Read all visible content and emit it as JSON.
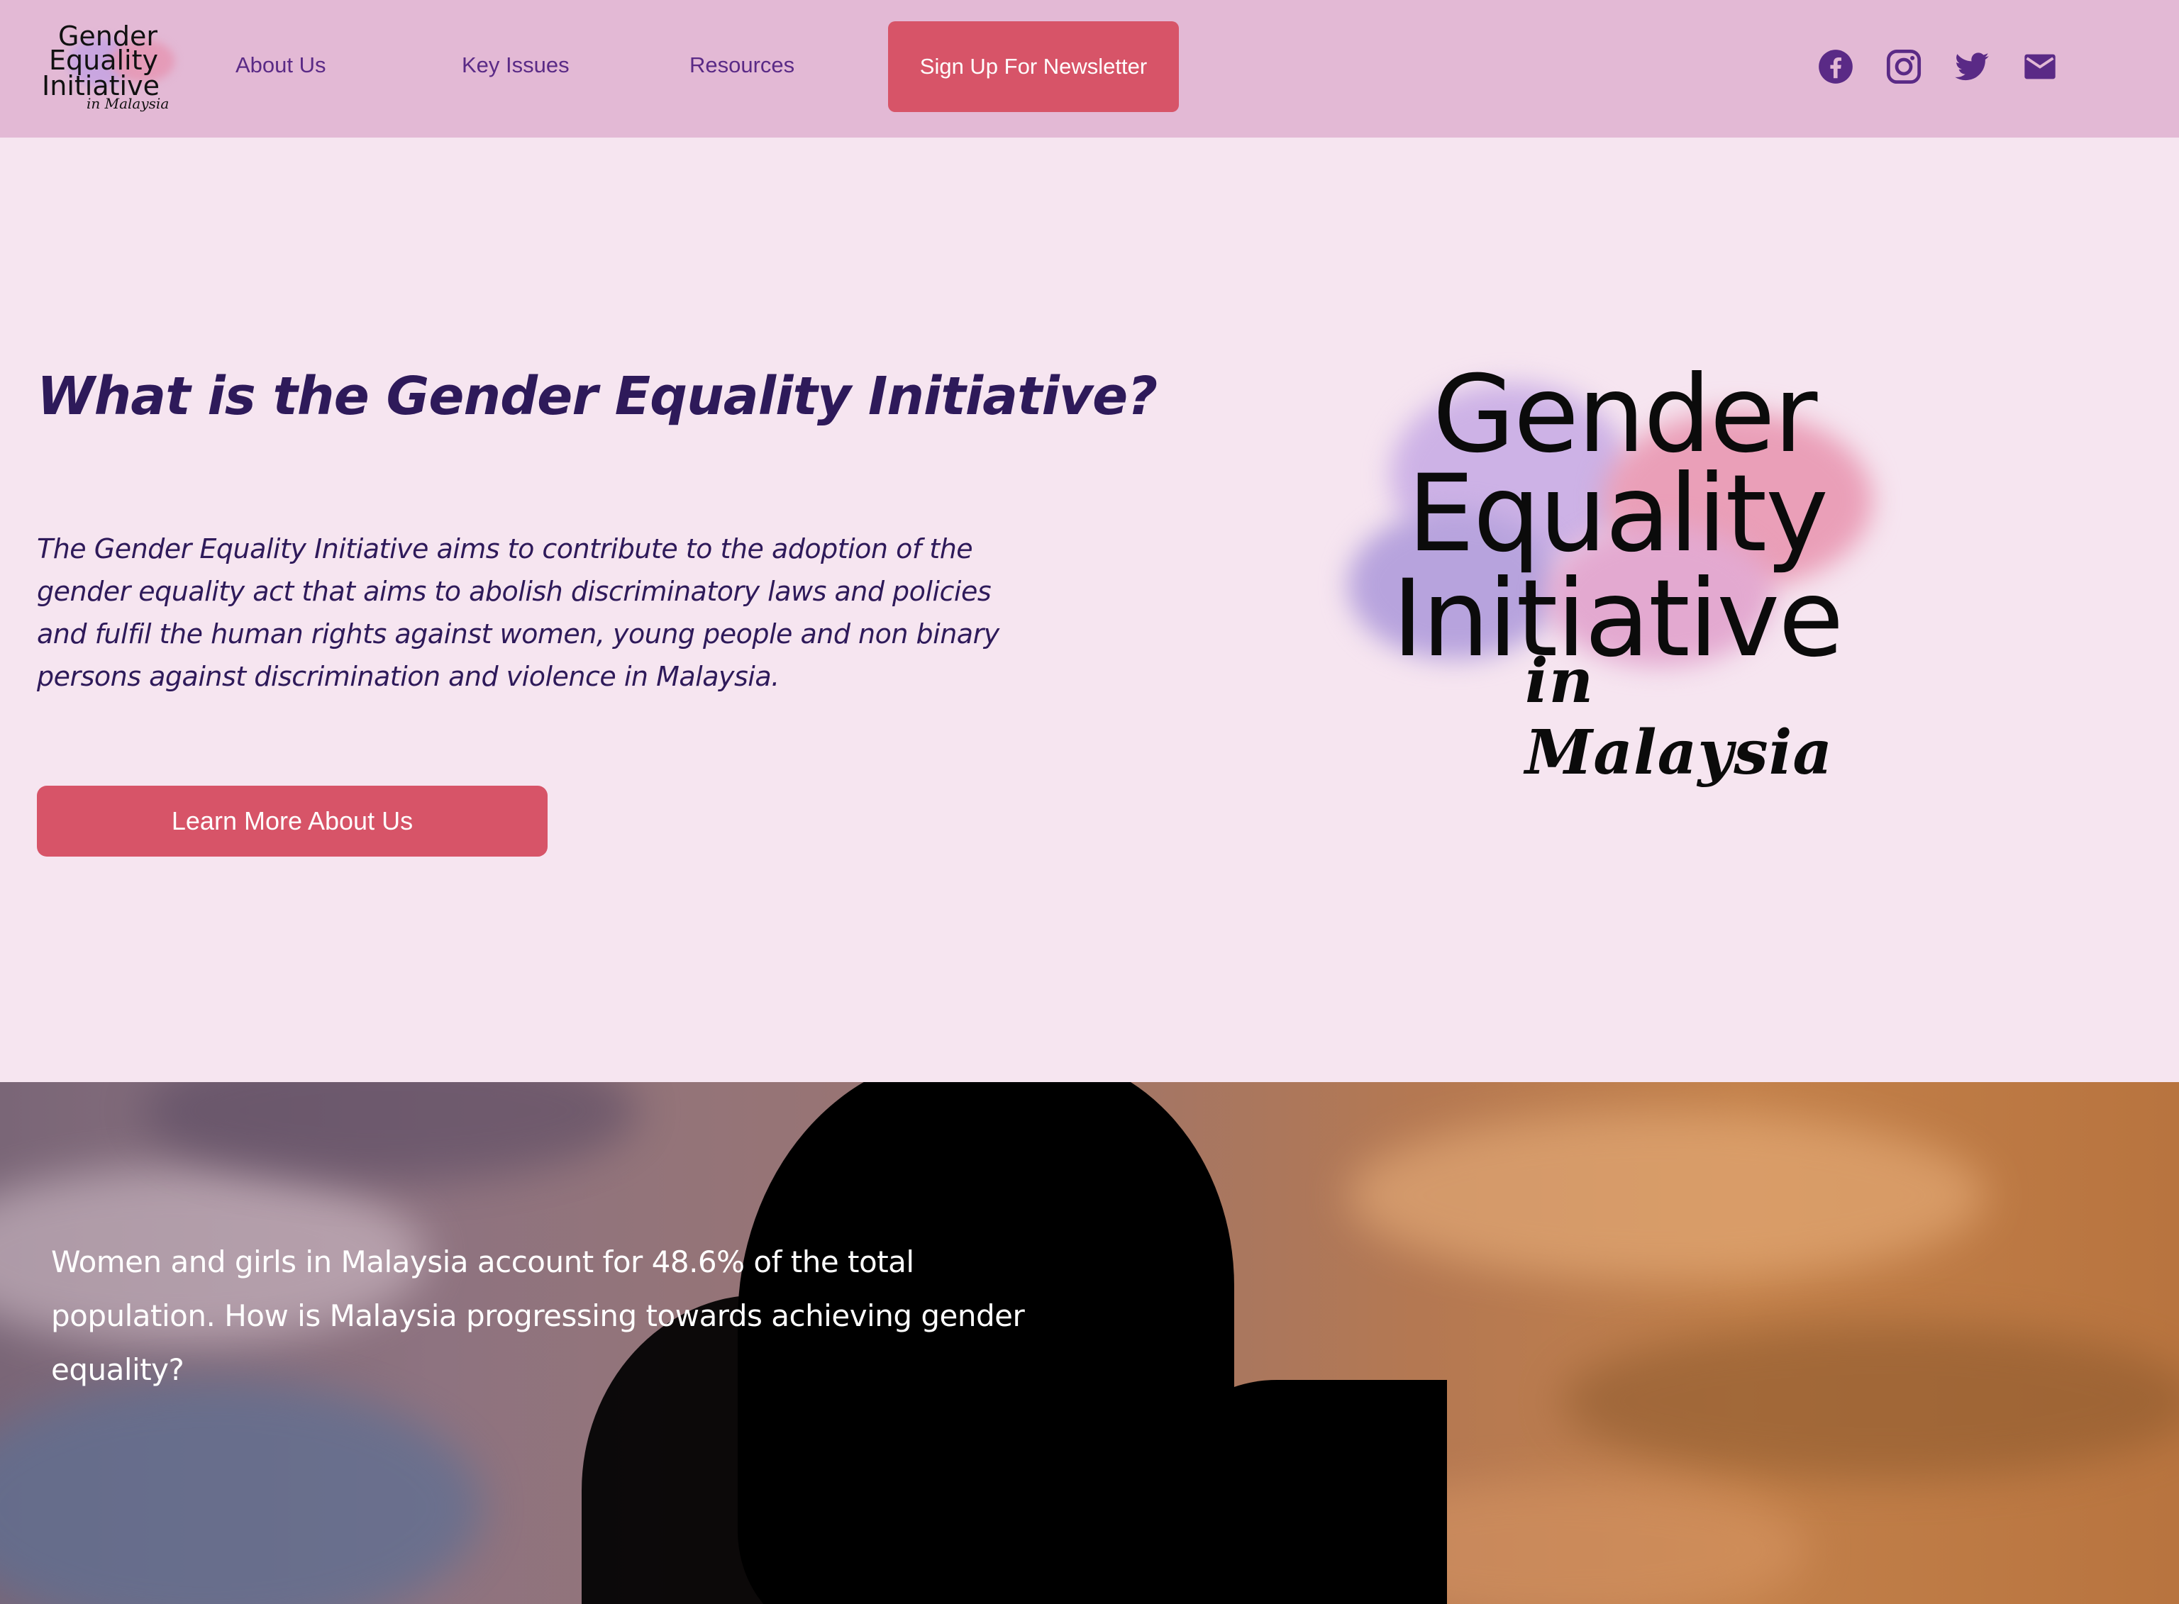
{
  "brand": {
    "logo_lines": [
      "Gender",
      "Equality",
      "Initiative"
    ],
    "logo_script": "in Malaysia"
  },
  "nav": {
    "items": [
      {
        "label": "About Us"
      },
      {
        "label": "Key Issues"
      },
      {
        "label": "Resources"
      }
    ],
    "newsletter_label": "Sign Up For Newsletter"
  },
  "social": [
    {
      "icon": "facebook-icon"
    },
    {
      "icon": "instagram-icon"
    },
    {
      "icon": "twitter-icon"
    },
    {
      "icon": "mail-icon"
    }
  ],
  "hero": {
    "title": "What is the Gender Equality Initiative?",
    "description": "The Gender Equality Initiative aims to contribute to the adoption of the gender equality act that aims to abolish discriminatory laws and policies and fulfil the human rights against women, young people and non binary persons against discrimination and violence in Malaysia.",
    "cta_label": "Learn More About Us"
  },
  "banner": {
    "text": "Women and girls in Malaysia account for 48.6% of the total population. How is Malaysia progressing towards achieving gender equality?"
  },
  "colors": {
    "header_bg": "#e3b9d5",
    "page_bg": "#f6e5f0",
    "accent_button": "#d75468",
    "nav_text": "#5a2a86",
    "heading_text": "#2e1a5a"
  }
}
